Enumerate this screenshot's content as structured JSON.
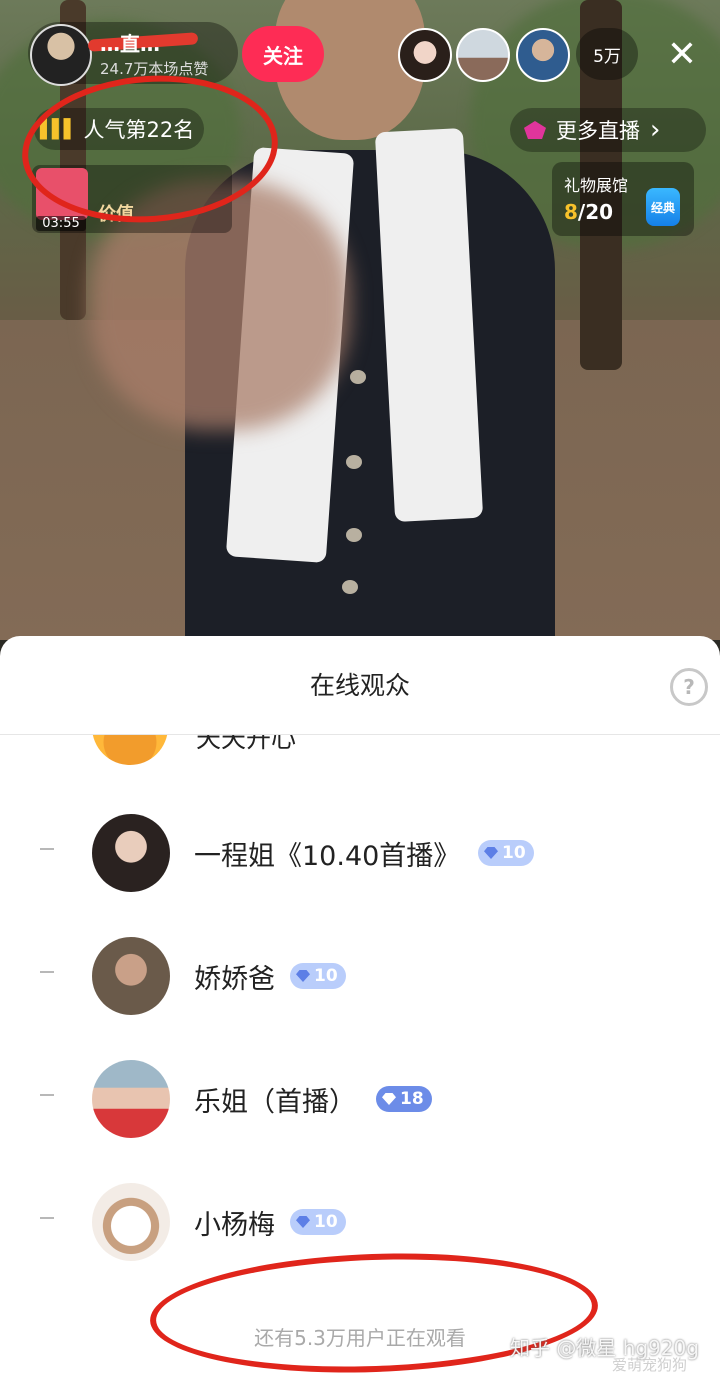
{
  "live": {
    "host_name": "…直…",
    "host_likes": "24.7万本场点赞",
    "follow_label": "关注",
    "viewer_count": "5万",
    "close_glyph": "✕",
    "rank_label": "人气第22名",
    "gift_timer": "03:55",
    "gift_text": "价值",
    "more_live_label": "更多直播",
    "more_live_arrow": "›",
    "gift_hall_title": "礼物展馆",
    "gift_hall_current": "8",
    "gift_hall_total": "/20",
    "gift_hall_badge": "经典"
  },
  "sheet": {
    "title": "在线观众",
    "help_glyph": "?",
    "partial_user": "天天开心",
    "users": [
      {
        "name": "一程姐《10.40首播》",
        "level": "10"
      },
      {
        "name": "娇娇爸",
        "level": "10"
      },
      {
        "name": "乐姐（首播）",
        "level": "18"
      },
      {
        "name": "小杨梅",
        "level": "10"
      }
    ],
    "footer": "还有5.3万用户正在观看"
  },
  "watermark": {
    "zhihu": "知乎 @微星 hg920g",
    "sub": "爱萌宠狗狗"
  },
  "colors": {
    "accent": "#fe2c55",
    "annotation": "#e0251b",
    "badge": "#b9cdfb"
  }
}
